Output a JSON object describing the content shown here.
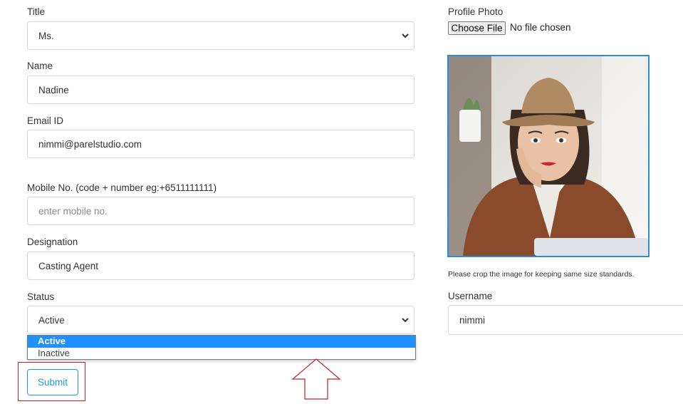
{
  "form": {
    "title": {
      "label": "Title",
      "value": "Ms."
    },
    "name": {
      "label": "Name",
      "value": "Nadine"
    },
    "email": {
      "label": "Email ID",
      "value": "nimmi@parelstudio.com"
    },
    "mobile": {
      "label": "Mobile No. (code + number eg:+6511111111)",
      "placeholder": "enter mobile no."
    },
    "designation": {
      "label": "Designation",
      "value": "Casting Agent"
    },
    "status": {
      "label": "Status",
      "value": "Active",
      "options": [
        "Active",
        "Inactive"
      ],
      "highlighted_option": "Active"
    },
    "submit_label": "Submit"
  },
  "profile": {
    "photo_label": "Profile Photo",
    "choose_file_label": "Choose File",
    "file_status": "No file chosen",
    "crop_note": "Please crop the image for keeping same size standards.",
    "username_label": "Username",
    "username_value": "nimmi"
  },
  "annotations": {
    "highlight_color": "#c0202a",
    "arrow_color": "#c0202a"
  },
  "colors": {
    "accent": "#1b9bd0",
    "dropdown_selected": "#1e90ff",
    "photo_border": "#2e8bd4"
  }
}
